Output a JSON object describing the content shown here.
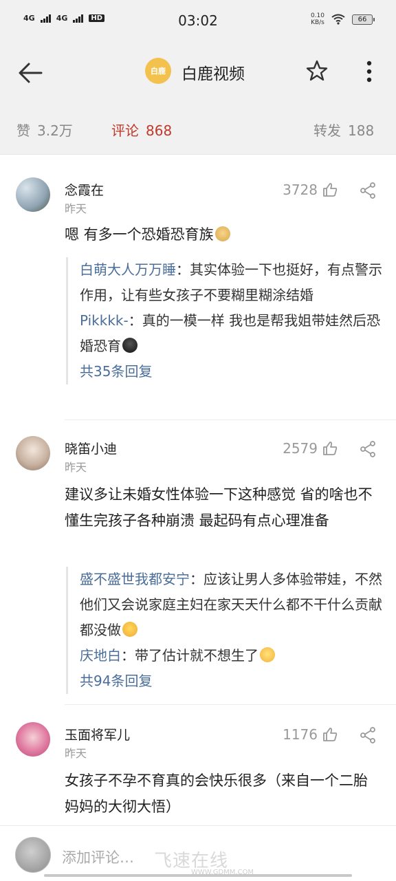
{
  "status_bar": {
    "time": "03:02",
    "net1": "4G",
    "net2": "4G",
    "hd": "HD",
    "speed_value": "0.10",
    "speed_unit": "KB/s",
    "battery": "66"
  },
  "header": {
    "logo_text": "白鹿",
    "title": "白鹿视频"
  },
  "stats": {
    "likes_label": "赞",
    "likes_value": "3.2万",
    "comments_label": "评论",
    "comments_value": "868",
    "reposts_label": "转发",
    "reposts_value": "188"
  },
  "comments": [
    {
      "user": "念霞在",
      "time": "昨天",
      "likes": "3728",
      "text": "嗯 有多一个恐婚恐育族",
      "replies": [
        {
          "who": "白萌大人万万睡",
          "text": "：其实体验一下也挺好，有点警示作用，让有些女孩子不要糊里糊涂结婚"
        },
        {
          "who": "Pikkkk-",
          "text": "：真的一模一样 我也是帮我姐带娃然后恐婚恐育"
        }
      ],
      "more": "共35条回复"
    },
    {
      "user": "晓笛小迪",
      "time": "昨天",
      "likes": "2579",
      "text": "建议多让未婚女性体验一下这种感觉 省的啥也不懂生完孩子各种崩溃 最起码有点心理准备",
      "replies": [
        {
          "who": "盛不盛世我都安宁",
          "text": "：应该让男人多体验带娃，不然他们又会说家庭主妇在家天天什么都不干什么贡献都没做"
        },
        {
          "who": "庆地白",
          "text": "：带了估计就不想生了"
        }
      ],
      "more": "共94条回复"
    },
    {
      "user": "玉面将军儿",
      "time": "昨天",
      "likes": "1176",
      "text": "女孩子不孕不育真的会快乐很多（来自一个二胎妈妈的大彻大悟）"
    }
  ],
  "bottom": {
    "placeholder": "添加评论…",
    "watermark": "飞速在线",
    "watermark_url": "WWW.GDMM.COM"
  }
}
